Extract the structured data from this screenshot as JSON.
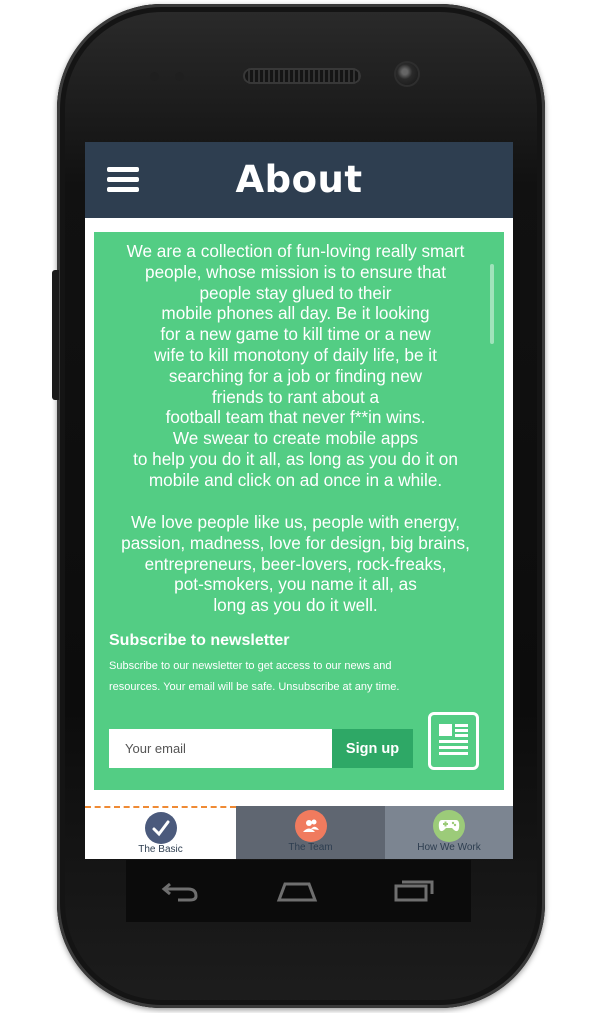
{
  "app": {
    "title": "About",
    "colors": {
      "appbar": "#2e3e50",
      "content_bg": "#53cd84",
      "signup_bg": "#2ea866",
      "tab_active_icon": "#4b5a7c",
      "tab_team_icon": "#f07b5e",
      "tab_how_icon": "#9ccb79"
    }
  },
  "menu": {
    "icon": "hamburger-menu-icon"
  },
  "about": {
    "paragraph1": "We are a collection of fun-loving really smart\npeople, whose mission is to ensure that\npeople stay glued to their\nmobile phones all day. Be it looking\nfor a new game to kill time or a new\nwife to kill monotony of daily life, be it\nsearching for a job or finding new\nfriends to rant about a\nfootball team that never f**in wins.\nWe swear to create mobile apps\nto help you do it all, as long as you do it on\nmobile and click on ad once in a while.",
    "paragraph2": "We love people like us, people with energy,\npassion, madness, love for design, big brains,\nentrepreneurs, beer-lovers, rock-freaks,\npot-smokers, you name it all, as\nlong as you do it well."
  },
  "newsletter": {
    "title": "Subscribe to newsletter",
    "description": "Subscribe to our newsletter to get access to our news and resources. Your email will be safe. Unsubscribe at any time.",
    "email_placeholder": "Your email",
    "email_value": "",
    "button_label": "Sign up",
    "icon": "newspaper-icon"
  },
  "tabs": [
    {
      "label": "The Basic",
      "icon": "checkmark-icon",
      "active": true
    },
    {
      "label": "The Team",
      "icon": "team-icon",
      "active": false
    },
    {
      "label": "How We Work",
      "icon": "gamepad-icon",
      "active": false
    }
  ],
  "system_nav": {
    "back": "back-icon",
    "home": "home-icon",
    "recents": "recents-icon"
  }
}
